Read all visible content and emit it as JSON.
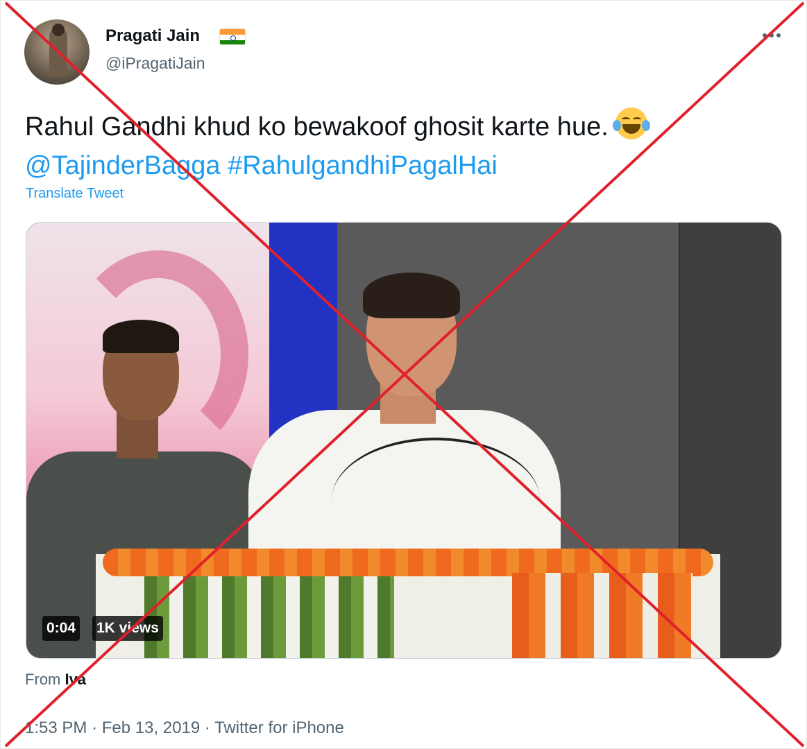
{
  "author": {
    "display_name": "Pragati Jain",
    "handle": "@iPragatiJain",
    "flag_emoji": "indian-flag"
  },
  "tweet": {
    "text_main": "Rahul Gandhi khud ko bewakoof ghosit karte hue.",
    "emoji": "face-with-tears-of-joy",
    "mention": "@TajinderBagga",
    "hashtag": "#RahulgandhiPagalHai",
    "translate_label": "Translate Tweet"
  },
  "media": {
    "duration": "0:04",
    "views": "1K views"
  },
  "source": {
    "prefix": "From",
    "name": "Iva"
  },
  "meta": {
    "time": "1:53 PM",
    "date": "Feb 13, 2019",
    "client": "Twitter for iPhone",
    "separator": "·"
  },
  "colors": {
    "link": "#1d9bf0",
    "cross": "#e0202a"
  }
}
